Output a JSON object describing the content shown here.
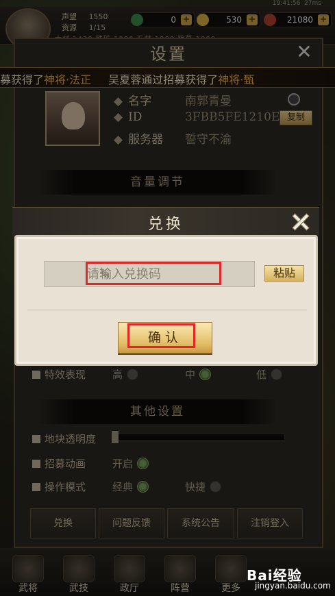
{
  "status_bar": {
    "time": "19:41:56",
    "battery": "27ms"
  },
  "top_bar": {
    "prestige_label": "声望",
    "prestige_value": "1550",
    "resource_label": "资源",
    "resource_value": "1/15",
    "res_a": "0",
    "res_b": "530",
    "res_c": "21080",
    "sub_resources": "大材 1430   铁矿 1000   石材 1000   粮草 1000"
  },
  "settings": {
    "title": "设置",
    "ticker": [
      {
        "prefix": "募获得了",
        "highlight": "神将·法正"
      },
      {
        "prefix": "吴夏蓉通过招募获得了",
        "highlight": "神将·甄"
      }
    ],
    "profile": {
      "name_label": "名字",
      "name_value": "南郭青曼",
      "id_label": "ID",
      "id_value": "3FBB5FE1210E",
      "server_label": "服务器",
      "server_value": "誓守不渝",
      "copy_label": "复制"
    },
    "volume_section": "音量调节",
    "effects_row": {
      "label": "特效表现",
      "options": [
        "高",
        "中",
        "低"
      ],
      "selected": "中"
    },
    "other_section": "其他设置",
    "tile_opacity": {
      "label": "地块透明度",
      "level": 0
    },
    "recruit_anim": {
      "label": "招募动画",
      "option": "开启"
    },
    "control_mode": {
      "label": "操作模式",
      "options": [
        "经典",
        "快捷"
      ],
      "selected": "经典"
    },
    "bottom_buttons": [
      "兑换",
      "问题反馈",
      "系统公告",
      "注销登入"
    ]
  },
  "dialog": {
    "title": "兑换",
    "input_placeholder": "请输入兑换码",
    "paste_label": "粘贴",
    "confirm_label": "确认"
  },
  "bottom_nav": [
    "武将",
    "武技",
    "政厅",
    "阵营",
    "更多"
  ],
  "watermark": {
    "brand": "Bai经验",
    "url": "jingyan.baidu.com"
  }
}
